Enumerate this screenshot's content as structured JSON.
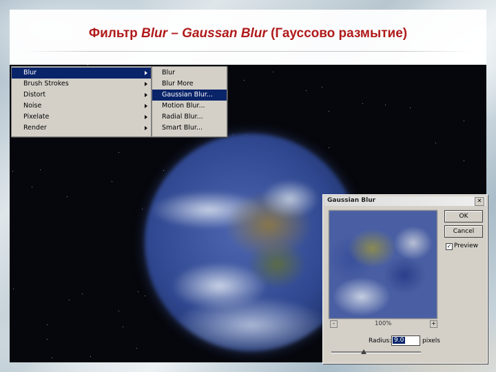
{
  "slide": {
    "title_prefix": "Фильтр ",
    "title_em": "Blur – Gaussan Blur",
    "title_suffix": " (Гауссово размытие)"
  },
  "filter_menu": {
    "items": [
      {
        "label": "Blur",
        "selected": true
      },
      {
        "label": "Brush Strokes"
      },
      {
        "label": "Distort"
      },
      {
        "label": "Noise"
      },
      {
        "label": "Pixelate"
      },
      {
        "label": "Render"
      }
    ]
  },
  "blur_submenu": {
    "items": [
      {
        "label": "Blur"
      },
      {
        "label": "Blur More"
      },
      {
        "label": "Gaussian Blur...",
        "selected": true
      },
      {
        "label": "Motion Blur..."
      },
      {
        "label": "Radial Blur..."
      },
      {
        "label": "Smart Blur..."
      }
    ]
  },
  "dialog": {
    "title": "Gaussian Blur",
    "close": "✕",
    "ok": "OK",
    "cancel": "Cancel",
    "preview_label": "Preview",
    "preview_checked": true,
    "check_mark": "✓",
    "zoom_minus": "-",
    "zoom_plus": "+",
    "zoom": "100%",
    "radius_label": "Radius:",
    "radius_value": "9.0",
    "unit": "pixels",
    "radius_slider_fraction": 0.36
  },
  "colors": {
    "title": "#b01a1a",
    "menu_highlight": "#0a246a",
    "dialog_bg": "#d4d0c8"
  }
}
